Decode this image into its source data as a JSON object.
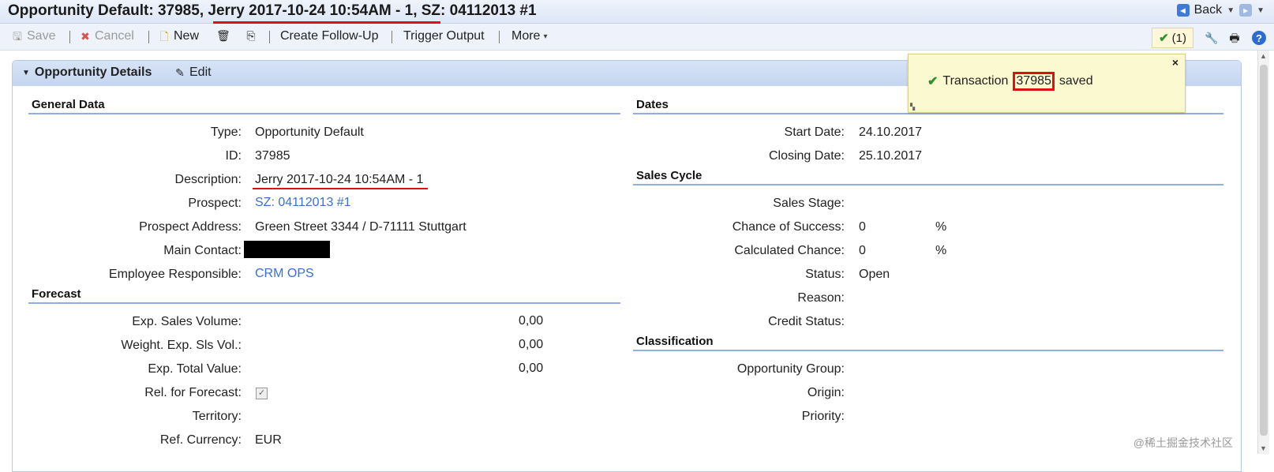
{
  "title": {
    "text": "Opportunity Default: 37985, Jerry 2017-10-24 10:54AM - 1, SZ: 04112013 #1"
  },
  "nav": {
    "back_label": "Back"
  },
  "toolbar": {
    "save_label": "Save",
    "cancel_label": "Cancel",
    "new_label": "New",
    "followup_label": "Create Follow-Up",
    "trigger_label": "Trigger Output",
    "more_label": "More",
    "messages_count": "(1)"
  },
  "panel": {
    "title": "Opportunity Details",
    "edit_label": "Edit"
  },
  "popup": {
    "prefix": "Transaction",
    "id": "37985",
    "suffix": "saved",
    "close_symbol": "×"
  },
  "general": {
    "title": "General Data",
    "type_label": "Type:",
    "type_value": "Opportunity Default",
    "id_label": "ID:",
    "id_value": "37985",
    "desc_label": "Description:",
    "desc_value": "Jerry 2017-10-24 10:54AM - 1",
    "prospect_label": "Prospect:",
    "prospect_value": "SZ: 04112013 #1",
    "address_label": "Prospect Address:",
    "address_value": "Green Street 3344 / D-71111 Stuttgart",
    "contact_label": "Main Contact:",
    "employee_label": "Employee Responsible:",
    "employee_value": "CRM OPS"
  },
  "forecast": {
    "title": "Forecast",
    "volume_label": "Exp. Sales Volume:",
    "volume_value": "0,00",
    "weight_label": "Weight. Exp. Sls Vol.:",
    "weight_value": "0,00",
    "total_label": "Exp. Total Value:",
    "total_value": "0,00",
    "rel_label": "Rel. for Forecast:",
    "territory_label": "Territory:",
    "currency_label": "Ref. Currency:",
    "currency_value": "EUR"
  },
  "dates": {
    "title": "Dates",
    "start_label": "Start Date:",
    "start_value": "24.10.2017",
    "closing_label": "Closing Date:",
    "closing_value": "25.10.2017"
  },
  "sales_cycle": {
    "title": "Sales Cycle",
    "stage_label": "Sales Stage:",
    "chance_label": "Chance of Success:",
    "chance_value": "0",
    "chance_unit": "%",
    "calc_label": "Calculated Chance:",
    "calc_value": "0",
    "calc_unit": "%",
    "status_label": "Status:",
    "status_value": "Open",
    "reason_label": "Reason:",
    "credit_label": "Credit Status:"
  },
  "classification": {
    "title": "Classification",
    "group_label": "Opportunity Group:",
    "origin_label": "Origin:",
    "priority_label": "Priority:"
  },
  "watermark": "@稀土掘金技术社区"
}
